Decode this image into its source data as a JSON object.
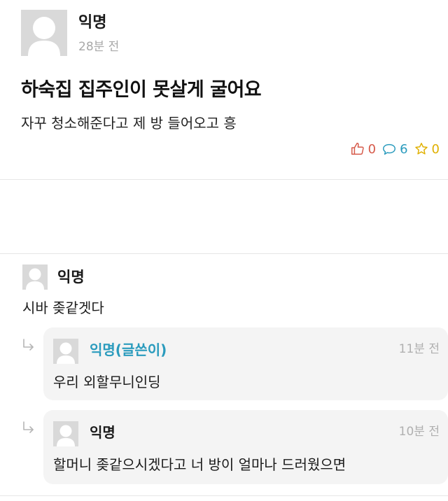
{
  "post": {
    "author": "익명",
    "time": "28분 전",
    "title": "하숙집 집주인이 못살게 굴어요",
    "body": "자꾸 청소해준다고 제 방 들어오고 흥",
    "stats": {
      "likes": "0",
      "comments": "6",
      "scraps": "0"
    }
  },
  "comment": {
    "author": "익명",
    "body": "시바 좆같겟다"
  },
  "replies": [
    {
      "author": "익명(글쓴이)",
      "time": "11분 전",
      "body": "우리 외할무니인딩"
    },
    {
      "author": "익명",
      "time": "10분 전",
      "body": "할머니 좆같으시겠다고 너 방이 얼마나 드러웠으면"
    }
  ],
  "colors": {
    "like": "#d65a4a",
    "comment": "#2a9bbd",
    "scrap": "#e0b000",
    "writer": "#2a9bbd"
  }
}
